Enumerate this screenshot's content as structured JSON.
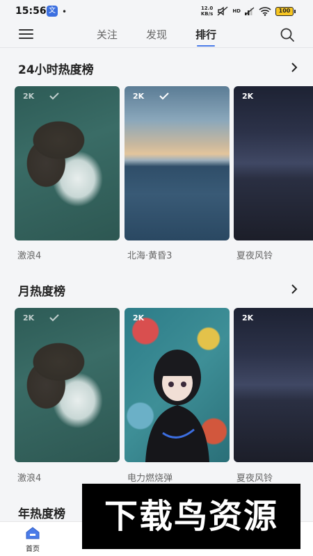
{
  "status": {
    "time": "15:56",
    "app_badge": "文",
    "dot": "•",
    "speed_top": "12.0",
    "speed_bottom": "KB/s",
    "hd": "HD",
    "battery": "100"
  },
  "nav": {
    "tabs": [
      "关注",
      "发现",
      "排行"
    ],
    "active_tab": "排行"
  },
  "sections": [
    {
      "title": "24小时热度榜",
      "items": [
        {
          "caption": "激浪4",
          "badge": "2K"
        },
        {
          "caption": "北海·黄昏3",
          "badge": "2K"
        },
        {
          "caption": "夏夜风铃",
          "badge": "2K"
        }
      ]
    },
    {
      "title": "月热度榜",
      "items": [
        {
          "caption": "激浪4",
          "badge": "2K"
        },
        {
          "caption": "电力燃烧弹",
          "badge": "2K"
        },
        {
          "caption": "夏夜风铃",
          "badge": "2K"
        }
      ]
    },
    {
      "title": "年热度榜"
    }
  ],
  "bottom_nav": {
    "home": "首页"
  },
  "watermark": "下载鸟资源",
  "colors": {
    "accent": "#4a7be8",
    "background": "#f4f5f7",
    "battery": "#f7c622"
  }
}
